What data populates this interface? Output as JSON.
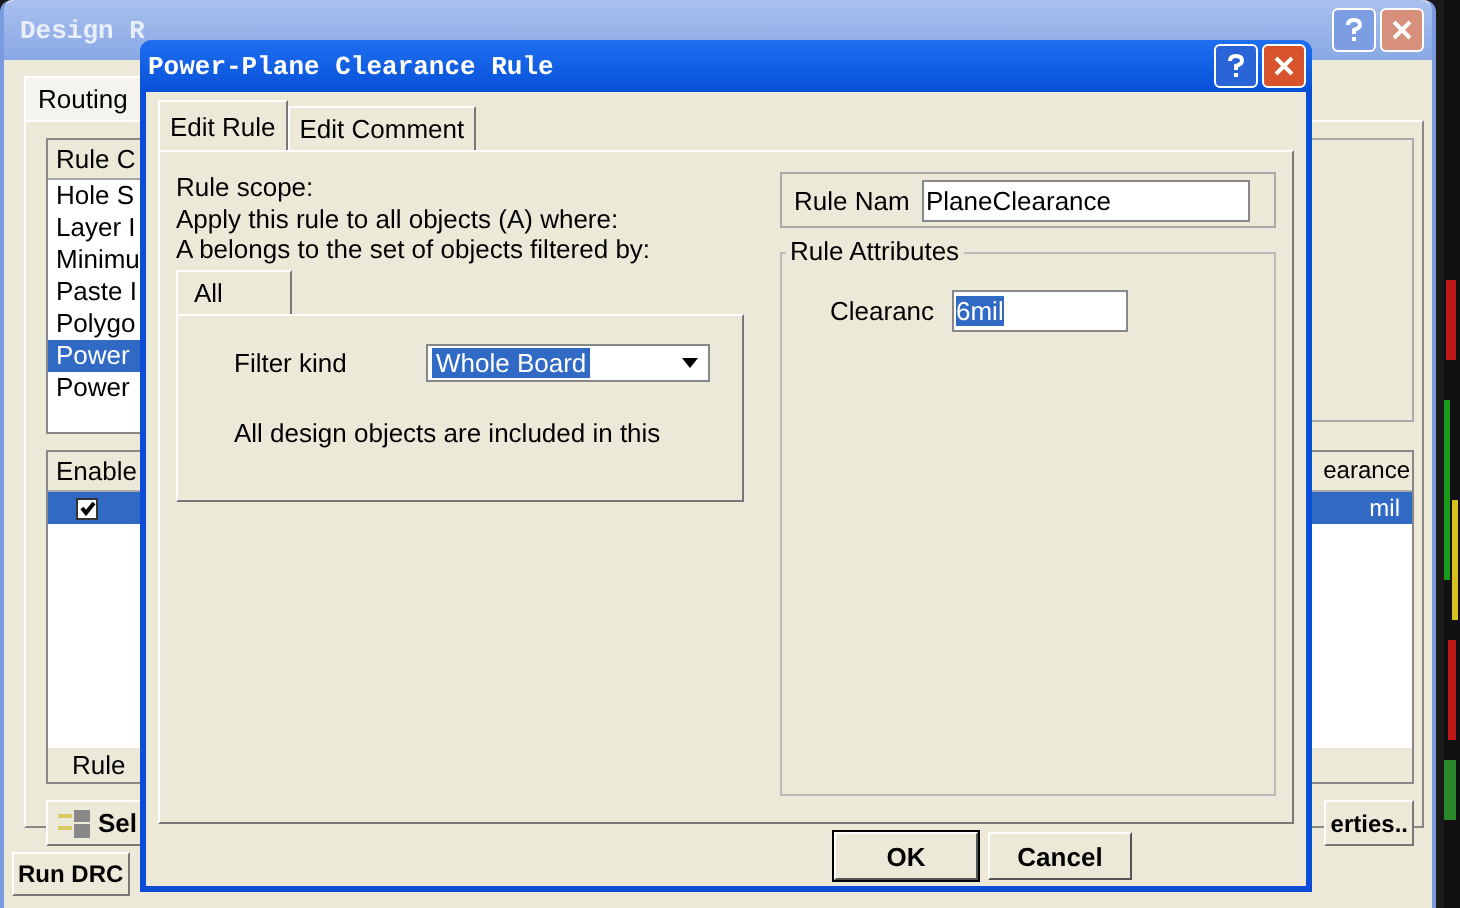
{
  "background_window": {
    "title": "Design R",
    "tabs": [
      {
        "label": "Routing",
        "selected": true
      }
    ],
    "rule_classes": {
      "header": "Rule C",
      "items": [
        {
          "label": "Hole S",
          "selected": false
        },
        {
          "label": "Layer I",
          "selected": false
        },
        {
          "label": "Minimu",
          "selected": false
        },
        {
          "label": "Paste I",
          "selected": false
        },
        {
          "label": "Polygo",
          "selected": false
        },
        {
          "label": "Power",
          "selected": true
        },
        {
          "label": "Power",
          "selected": false
        }
      ]
    },
    "rules_table": {
      "columns": [
        "Enable",
        "earance"
      ],
      "rows": [
        {
          "enabled": true,
          "column_2": "mil",
          "selected": true
        }
      ],
      "footer": "Rule"
    },
    "select_button": "Sel",
    "properties_button": "erties..",
    "run_drc_button": "Run DRC"
  },
  "dialog": {
    "title": "Power-Plane Clearance Rule",
    "tabs": [
      {
        "label": "Edit Rule",
        "selected": true
      },
      {
        "label": "Edit Comment",
        "selected": false
      }
    ],
    "scope_lines": [
      "Rule scope:",
      "Apply this rule to all objects (A) where:",
      "A belongs to the set of objects filtered by:"
    ],
    "filter_tabs": [
      {
        "label": "All",
        "selected": true
      }
    ],
    "filter_kind_label": "Filter kind",
    "filter_kind_value": "Whole Board",
    "filter_description": "All design objects are included in this",
    "rule_name_label": "Rule Nam",
    "rule_name_value": "PlaneClearance",
    "attributes_title": "Rule Attributes",
    "clearance_label": "Clearanc",
    "clearance_value": "6mil",
    "buttons": [
      "OK",
      "Cancel"
    ]
  }
}
